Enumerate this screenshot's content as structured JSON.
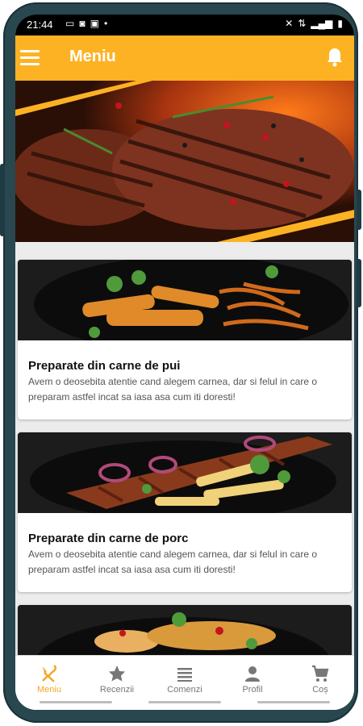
{
  "status_bar": {
    "time": "21:44"
  },
  "app_bar": {
    "title": "Meniu"
  },
  "categories": [
    {
      "title": "Preparate din carne de pui",
      "description": "Avem o deosebita atentie cand alegem carnea, dar si felul in care o preparam astfel incat sa iasa asa cum iti doresti!"
    },
    {
      "title": "Preparate din carne de porc",
      "description": "Avem o deosebita atentie cand alegem carnea, dar si felul in care o preparam astfel incat sa iasa asa cum iti doresti!"
    }
  ],
  "bottom_nav": [
    {
      "label": "Meniu",
      "icon": "cutlery-icon",
      "active": true
    },
    {
      "label": "Recenzii",
      "icon": "star-icon",
      "active": false
    },
    {
      "label": "Comenzi",
      "icon": "list-icon",
      "active": false
    },
    {
      "label": "Profil",
      "icon": "person-icon",
      "active": false
    },
    {
      "label": "Coș",
      "icon": "cart-icon",
      "active": false
    }
  ],
  "colors": {
    "accent": "#fdb224",
    "active_nav": "#f5a623",
    "inactive_nav": "#777777"
  }
}
